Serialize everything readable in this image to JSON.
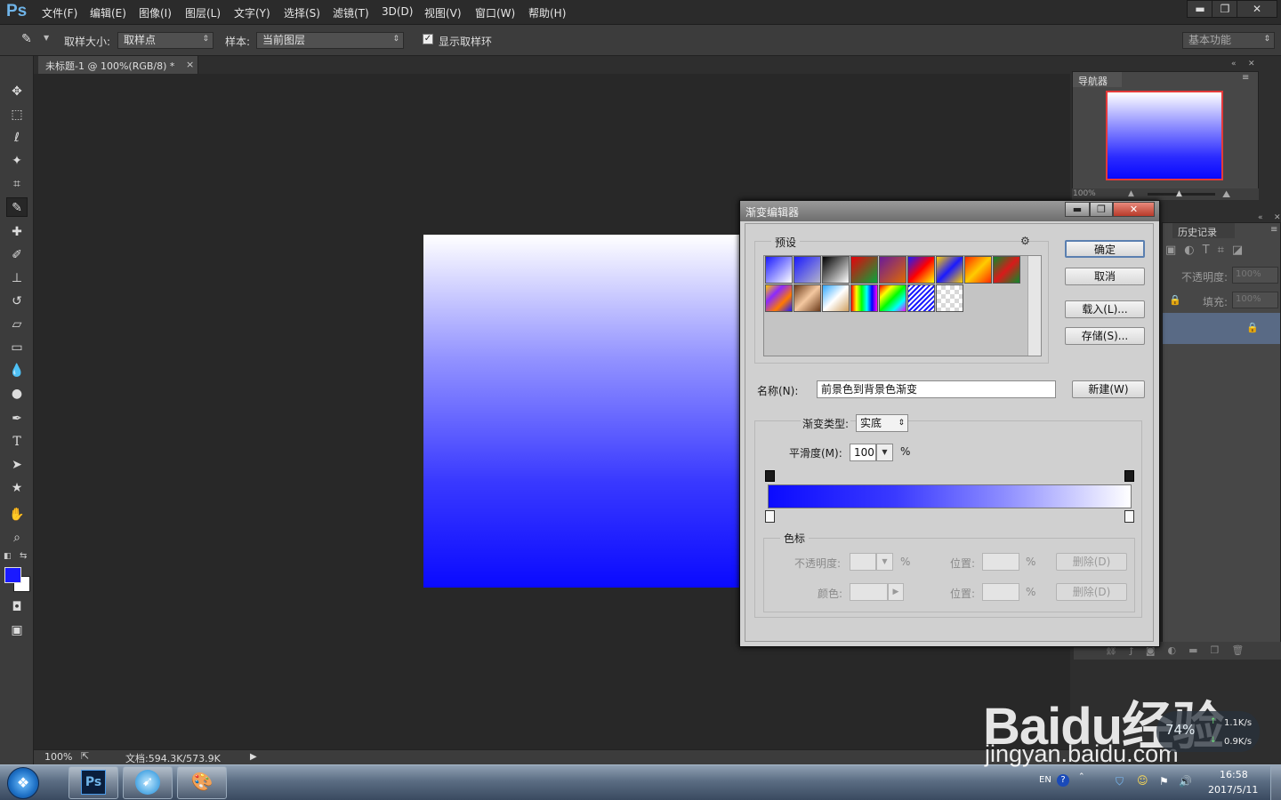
{
  "app": {
    "logo": "Ps"
  },
  "menu": [
    "文件(F)",
    "编辑(E)",
    "图像(I)",
    "图层(L)",
    "文字(Y)",
    "选择(S)",
    "滤镜(T)",
    "3D(D)",
    "视图(V)",
    "窗口(W)",
    "帮助(H)"
  ],
  "window_controls": {
    "minimize": "▬",
    "restore": "❐",
    "close": "✕"
  },
  "options": {
    "sample_size_label": "取样大小:",
    "sample_size_value": "取样点",
    "sample_label": "样本:",
    "sample_value": "当前图层",
    "show_ring_label": "显示取样环",
    "show_ring_checked": true,
    "workspace": "基本功能"
  },
  "document": {
    "tab_title": "未标题-1 @ 100%(RGB/8) *",
    "tab_close": "×"
  },
  "status": {
    "zoom": "100%",
    "doc_size": "文档:594.3K/573.9K"
  },
  "colors": {
    "foreground": "#1a1aff",
    "background": "#ffffff"
  },
  "panels": {
    "navigator_tab": "导航器",
    "navigator_zoom": "100%",
    "history_tab": "历史记录",
    "opacity_label": "不透明度:",
    "opacity_value": "100%",
    "fill_label": "填充:",
    "fill_value": "100%"
  },
  "dialog": {
    "title": "渐变编辑器",
    "presets_label": "预设",
    "ok": "确定",
    "cancel": "取消",
    "load": "载入(L)...",
    "save": "存储(S)...",
    "name_label": "名称(N):",
    "name_value": "前景色到背景色渐变",
    "new_button": "新建(W)",
    "type_label": "渐变类型:",
    "type_value": "实底",
    "smoothness_label": "平滑度(M):",
    "smoothness_value": "100",
    "percent": "%",
    "stops_label": "色标",
    "opacity_label": "不透明度:",
    "color_label": "颜色:",
    "location_label": "位置:",
    "delete_label": "删除(D)",
    "presets": [
      "linear-gradient(135deg,#1a1aff,#ffffff)",
      "linear-gradient(135deg,#1a1aff 0%,rgba(26,26,255,0.1) 100%)",
      "linear-gradient(135deg,#000,#fff)",
      "linear-gradient(135deg,#e8000b,#06a63a)",
      "linear-gradient(135deg,#6a1a9a,#e06a00)",
      "linear-gradient(135deg,#1a1aff,#ff0000,#ffff00)",
      "linear-gradient(135deg,#ffd000,#1a1aff,#ffd000)",
      "linear-gradient(135deg,#ff2a00,#ffcc00,#ff2a00)",
      "linear-gradient(135deg,#0a8a2a,#d81a1a,#0a8a2a)",
      "linear-gradient(135deg,#ffc800,#8a2aff,#ff7a00,#1a1aff)",
      "linear-gradient(135deg,#6b3a1a,#f4c8a0,#6b3a1a)",
      "linear-gradient(135deg,#30a8ff,#ffffff,#d0a060)",
      "linear-gradient(90deg,#ff0000,#ffff00,#00ff00,#00ffff,#0000ff,#ff00ff)",
      "linear-gradient(135deg,#ff0000,#ffff00,#00ff00,#00ffff,#ff00ff)",
      "repeating-linear-gradient(135deg,#1a1aff 0px,#1a1aff 2px,#ffffff 2px,#ffffff 4px)",
      "repeating-conic-gradient(#d8d8d8 0 25%,#ffffff 0 50%)"
    ]
  },
  "taskbar": {
    "lang": "EN",
    "time": "16:58",
    "date": "2017/5/11",
    "net_up": "1.1K/s",
    "net_down": "0.9K/s",
    "cpu": "74%"
  },
  "watermark": {
    "brand": "Baidu经验",
    "url": "jingyan.baidu.com"
  }
}
